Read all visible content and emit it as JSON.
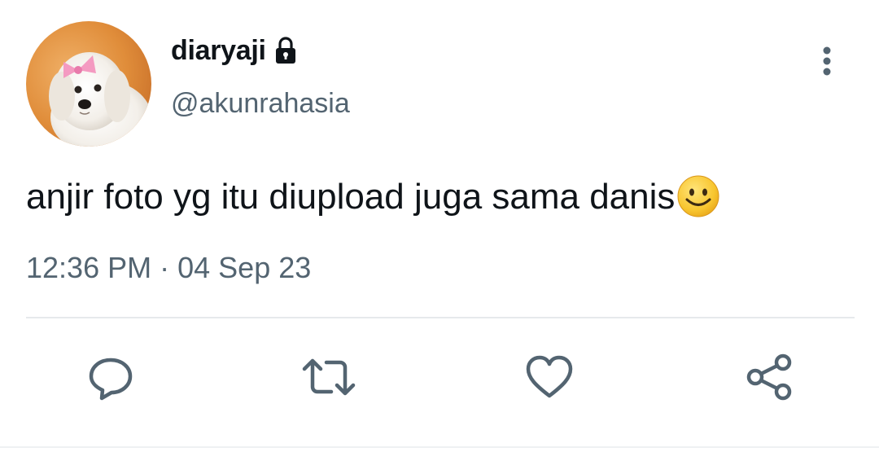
{
  "author": {
    "display_name": "diaryaji",
    "handle": "@akunrahasia",
    "protected": true,
    "avatar_icon": "puppy-avatar"
  },
  "tweet": {
    "text": "anjir foto yg itu diupload juga sama danis",
    "emoji": "smiling-face",
    "time": "12:36 PM",
    "separator": "·",
    "date": "04 Sep 23"
  },
  "actions": {
    "reply_icon": "reply-icon",
    "retweet_icon": "retweet-icon",
    "like_icon": "like-icon",
    "share_icon": "share-icon",
    "more_icon": "more-vertical-icon"
  },
  "colors": {
    "text_primary": "#0f1419",
    "text_secondary": "#536471",
    "divider": "#e6e9ec",
    "icon": "#536471"
  }
}
